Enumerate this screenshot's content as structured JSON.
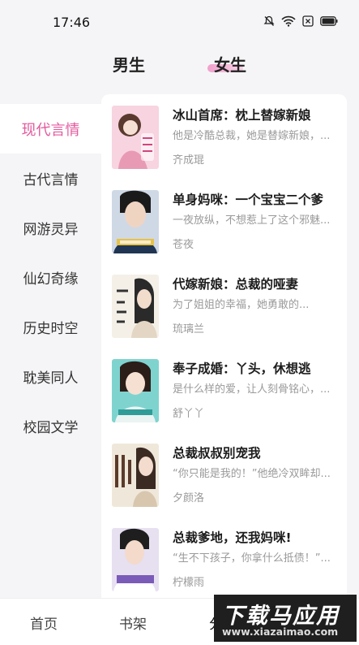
{
  "status": {
    "time": "17:46"
  },
  "tabs": {
    "male": "男生",
    "female": "女生"
  },
  "categories": [
    "现代言情",
    "古代言情",
    "网游灵异",
    "仙幻奇缘",
    "历史时空",
    "耽美同人",
    "校园文学"
  ],
  "books": [
    {
      "title": "冰山首席：枕上替嫁新娘",
      "desc": "他是冷酷总裁，她是替嫁新娘，...",
      "author": "齐成琨",
      "cover_colors": [
        "#f7c9d8",
        "#e8a2b8"
      ]
    },
    {
      "title": "单身妈咪：一个宝宝二个爹",
      "desc": "一夜放纵，不想惹上了这个邪魅...",
      "author": "苍夜",
      "cover_colors": [
        "#233a5a",
        "#6b8fb4"
      ]
    },
    {
      "title": "代嫁新娘：总裁的哑妻",
      "desc": "为了姐姐的幸福，她勇敢的...",
      "author": "琉璃兰",
      "cover_colors": [
        "#f1ede4",
        "#c9b8a3"
      ]
    },
    {
      "title": "奉子成婚：丫头，休想逃",
      "desc": "是什么样的爱，让人刻骨铭心，...",
      "author": "舒丫丫",
      "cover_colors": [
        "#5fc7c2",
        "#2f9c98"
      ]
    },
    {
      "title": "总裁叔叔别宠我",
      "desc": "“你只能是我的！”他绝冷双眸却...",
      "author": "夕颜洛",
      "cover_colors": [
        "#eae3d4",
        "#b9a48a"
      ]
    },
    {
      "title": "总裁爹地，还我妈咪!",
      "desc": "“生不下孩子，你拿什么抵债！”...",
      "author": "柠檬雨",
      "cover_colors": [
        "#d9d0ea",
        "#6c5aa3"
      ]
    }
  ],
  "nav": {
    "home": "首页",
    "shelf": "书架",
    "category": "分"
  },
  "watermark": {
    "main": "下载马应用",
    "url": "www.xiazaimao.com"
  },
  "colors": {
    "accent": "#e35a9e"
  }
}
